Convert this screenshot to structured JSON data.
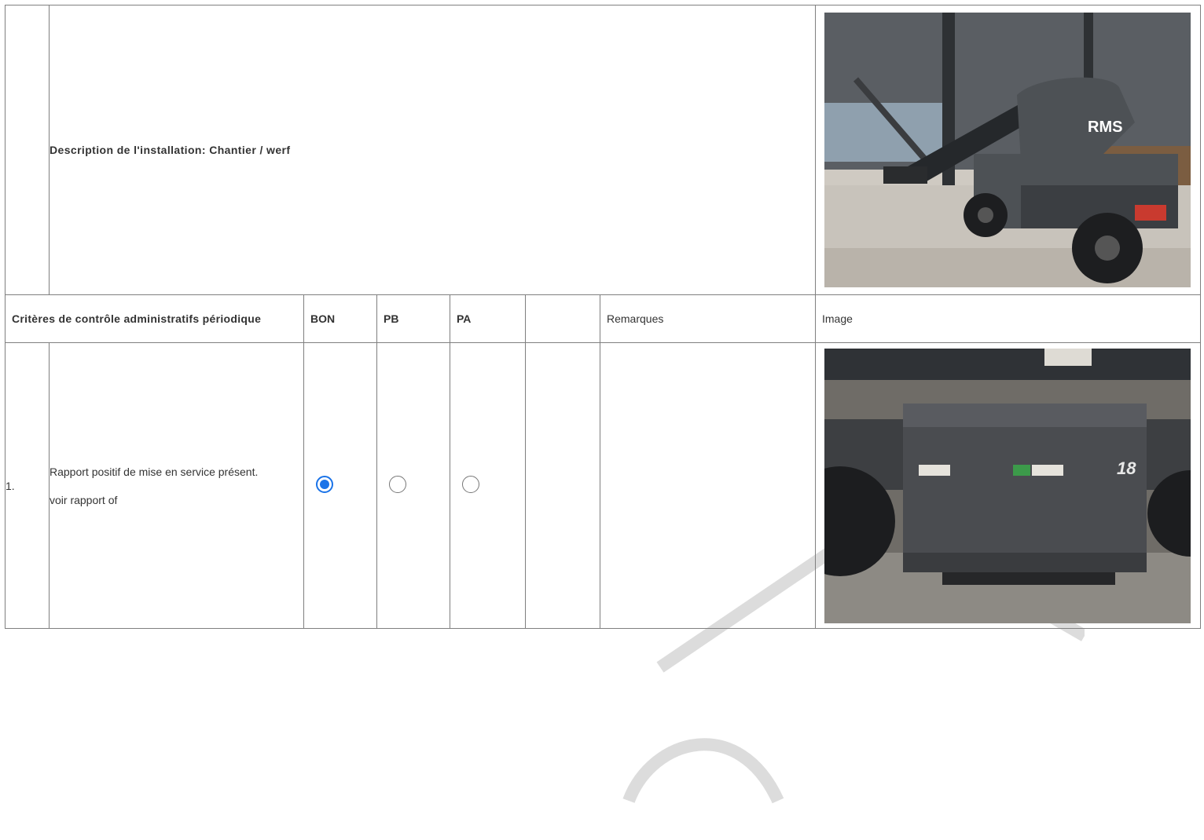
{
  "installation": {
    "description": "Description de l'installation: Chantier / werf"
  },
  "header": {
    "criteria": "Critères de contrôle administratifs périodique",
    "bon": "BON",
    "pb": "PB",
    "pa": "PA",
    "blank": "",
    "remarks": "Remarques",
    "image": "Image"
  },
  "rows": [
    {
      "number": "1.",
      "text": "Rapport positif de mise en service présent.",
      "note": "voir rapport of",
      "selected": "BON",
      "remarks": ""
    }
  ],
  "photos": {
    "machine_brand": "RMS",
    "counterweight_number": "18"
  },
  "colors": {
    "radio_selected": "#1a73e8",
    "border": "#7f7f7f"
  }
}
